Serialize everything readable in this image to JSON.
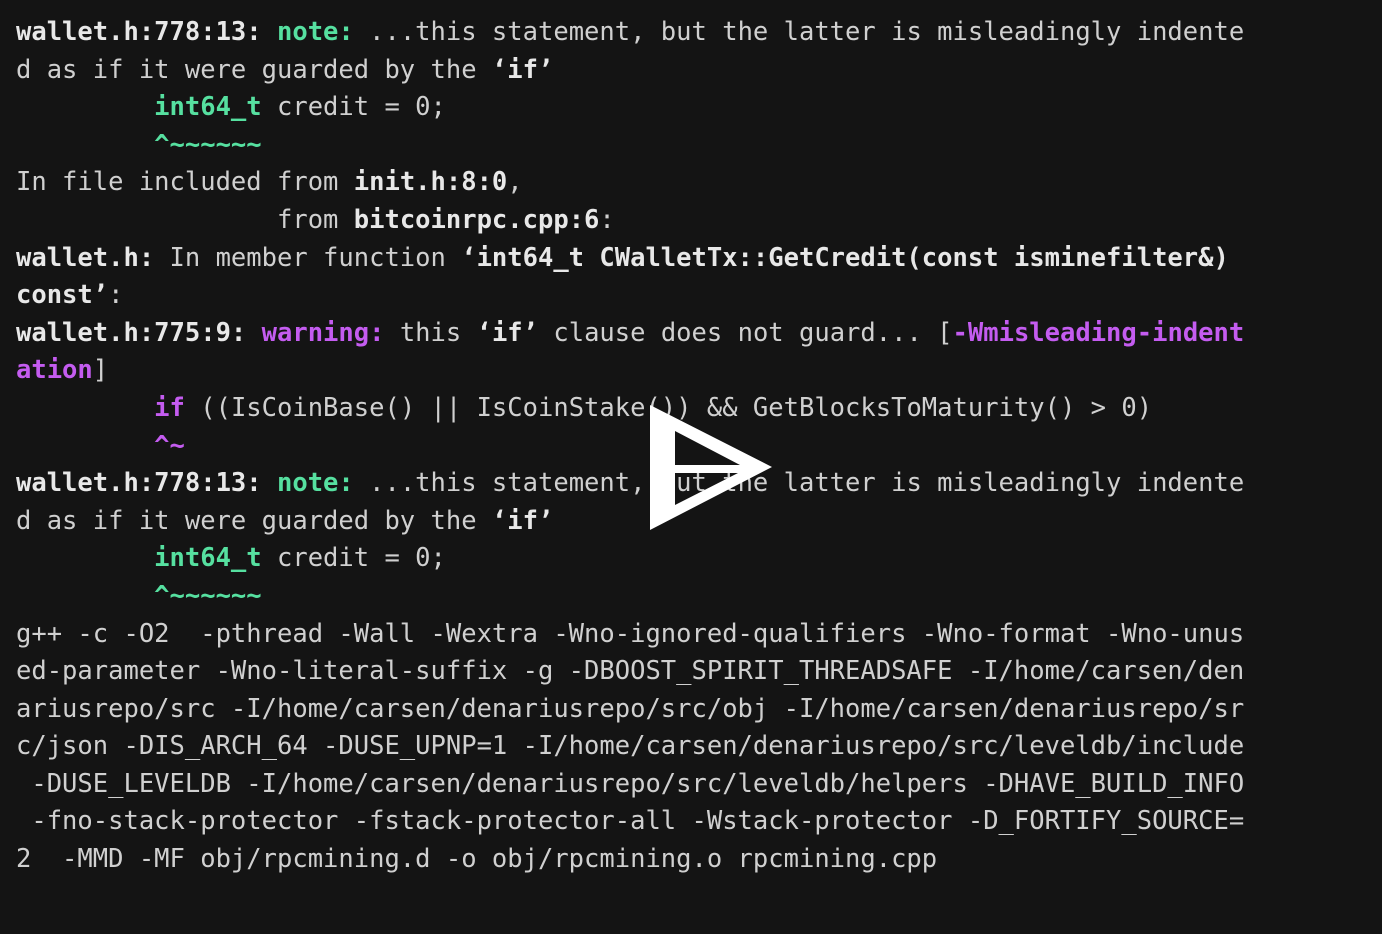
{
  "terminal": {
    "background_color": "#141414",
    "foreground_color": "#d0d0d0",
    "accent_green": "#56e0a0",
    "accent_magenta": "#c45cf0",
    "bold_white": "#e8e8e8",
    "lines": [
      {
        "id": "line-1",
        "segments": [
          {
            "text": "wallet.h:778:13: ",
            "style": "bold-white"
          },
          {
            "text": "note:",
            "style": "green"
          },
          {
            "text": " ...this statement, but the latter is misleadingly indente",
            "style": "default"
          }
        ]
      },
      {
        "id": "line-2",
        "segments": [
          {
            "text": "d as if it were guarded by the ",
            "style": "default"
          },
          {
            "text": "‘if’",
            "style": "bold-white"
          }
        ]
      },
      {
        "id": "line-3",
        "segments": [
          {
            "text": "         ",
            "style": "default"
          },
          {
            "text": "int64_t",
            "style": "green"
          },
          {
            "text": " credit = 0;",
            "style": "default"
          }
        ]
      },
      {
        "id": "line-4",
        "segments": [
          {
            "text": "         ",
            "style": "default"
          },
          {
            "text": "^~~~~~~",
            "style": "green"
          }
        ]
      },
      {
        "id": "line-5",
        "segments": [
          {
            "text": "In file included from ",
            "style": "default"
          },
          {
            "text": "init.h:8:0",
            "style": "bold-white"
          },
          {
            "text": ",",
            "style": "default"
          }
        ]
      },
      {
        "id": "line-6",
        "segments": [
          {
            "text": "                 from ",
            "style": "default"
          },
          {
            "text": "bitcoinrpc.cpp:6",
            "style": "bold-white"
          },
          {
            "text": ":",
            "style": "default"
          }
        ]
      },
      {
        "id": "line-7",
        "segments": [
          {
            "text": "wallet.h:",
            "style": "bold-white"
          },
          {
            "text": " In member function ",
            "style": "default"
          },
          {
            "text": "‘int64_t CWalletTx::GetCredit(const isminefilter&)",
            "style": "bold-white"
          }
        ]
      },
      {
        "id": "line-8",
        "segments": [
          {
            "text": "const’",
            "style": "bold-white"
          },
          {
            "text": ":",
            "style": "default"
          }
        ]
      },
      {
        "id": "line-9",
        "segments": [
          {
            "text": "wallet.h:775:9: ",
            "style": "bold-white"
          },
          {
            "text": "warning:",
            "style": "magenta"
          },
          {
            "text": " this ",
            "style": "default"
          },
          {
            "text": "‘if’",
            "style": "bold-white"
          },
          {
            "text": " clause does not guard... [",
            "style": "default"
          },
          {
            "text": "-Wmisleading-indent",
            "style": "magenta"
          }
        ]
      },
      {
        "id": "line-10",
        "segments": [
          {
            "text": "ation",
            "style": "magenta"
          },
          {
            "text": "]",
            "style": "default"
          }
        ]
      },
      {
        "id": "line-11",
        "segments": [
          {
            "text": "         ",
            "style": "default"
          },
          {
            "text": "if",
            "style": "magenta"
          },
          {
            "text": " ((IsCoinBase() || IsCoinStake()) && GetBlocksToMaturity() > 0)",
            "style": "default"
          }
        ]
      },
      {
        "id": "line-12",
        "segments": [
          {
            "text": "         ",
            "style": "default"
          },
          {
            "text": "^~",
            "style": "magenta"
          }
        ]
      },
      {
        "id": "line-13",
        "segments": [
          {
            "text": "wallet.h:778:13: ",
            "style": "bold-white"
          },
          {
            "text": "note:",
            "style": "green"
          },
          {
            "text": " ...this statement, but the latter is misleadingly indente",
            "style": "default"
          }
        ]
      },
      {
        "id": "line-14",
        "segments": [
          {
            "text": "d as if it were guarded by the ",
            "style": "default"
          },
          {
            "text": "‘if’",
            "style": "bold-white"
          }
        ]
      },
      {
        "id": "line-15",
        "segments": [
          {
            "text": "         ",
            "style": "default"
          },
          {
            "text": "int64_t",
            "style": "green"
          },
          {
            "text": " credit = 0;",
            "style": "default"
          }
        ]
      },
      {
        "id": "line-16",
        "segments": [
          {
            "text": "         ",
            "style": "default"
          },
          {
            "text": "^~~~~~~",
            "style": "green"
          }
        ]
      },
      {
        "id": "line-17",
        "segments": [
          {
            "text": "g++ -c -O2  -pthread -Wall -Wextra -Wno-ignored-qualifiers -Wno-format -Wno-unus",
            "style": "default"
          }
        ]
      },
      {
        "id": "line-18",
        "segments": [
          {
            "text": "ed-parameter -Wno-literal-suffix -g -DBOOST_SPIRIT_THREADSAFE -I/home/carsen/den",
            "style": "default"
          }
        ]
      },
      {
        "id": "line-19",
        "segments": [
          {
            "text": "ariusrepo/src -I/home/carsen/denariusrepo/src/obj -I/home/carsen/denariusrepo/sr",
            "style": "default"
          }
        ]
      },
      {
        "id": "line-20",
        "segments": [
          {
            "text": "c/json -DIS_ARCH_64 -DUSE_UPNP=1 -I/home/carsen/denariusrepo/src/leveldb/include",
            "style": "default"
          }
        ]
      },
      {
        "id": "line-21",
        "segments": [
          {
            "text": " -DUSE_LEVELDB -I/home/carsen/denariusrepo/src/leveldb/helpers -DHAVE_BUILD_INFO",
            "style": "default"
          }
        ]
      },
      {
        "id": "line-22",
        "segments": [
          {
            "text": " -fno-stack-protector -fstack-protector-all -Wstack-protector -D_FORTIFY_SOURCE=",
            "style": "default"
          }
        ]
      },
      {
        "id": "line-23",
        "segments": [
          {
            "text": "2  -MMD -MF obj/rpcmining.d -o obj/rpcmining.o rpcmining.cpp",
            "style": "default"
          }
        ]
      }
    ]
  },
  "player": {
    "play_button_label": "Play",
    "play_button_color": "#ffffff",
    "icon": "play-triangle-icon"
  }
}
